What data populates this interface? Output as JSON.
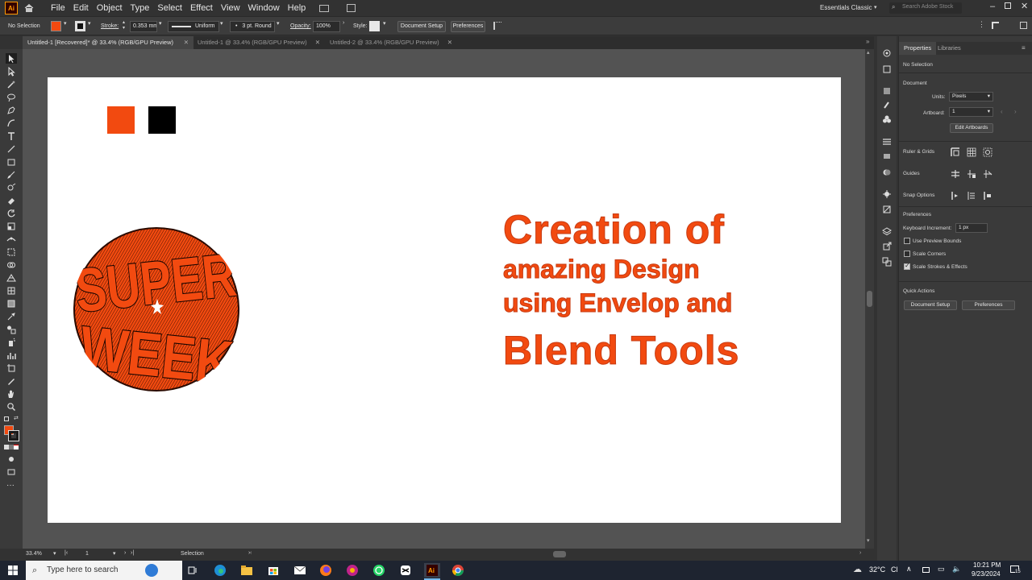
{
  "menubar": {
    "app_logo": "Ai",
    "items": [
      "File",
      "Edit",
      "Object",
      "Type",
      "Select",
      "Effect",
      "View",
      "Window",
      "Help"
    ],
    "workspace": "Essentials Classic",
    "search_placeholder": "Search Adobe Stock"
  },
  "controlbar": {
    "selection": "No Selection",
    "stroke_label": "Stroke:",
    "stroke_value": "0.353 mm",
    "profile": "Uniform",
    "brush": "3 pt. Round",
    "opacity_label": "Opacity:",
    "opacity_value": "100%",
    "style_label": "Style:",
    "doc_setup": "Document Setup",
    "preferences": "Preferences",
    "fill_color": "#f24a10"
  },
  "tabs": [
    {
      "label": "Untitled-1 [Recovered]* @ 33.4% (RGB/GPU Preview)",
      "active": true
    },
    {
      "label": "Untitled-1 @ 33.4% (RGB/GPU Preview)",
      "active": false
    },
    {
      "label": "Untitled-2 @ 33.4% (RGB/GPU Preview)",
      "active": false
    }
  ],
  "artwork": {
    "swatch_colors": [
      "#f24a10",
      "#000000"
    ],
    "logo_words": [
      "SUPER",
      "WEEK"
    ],
    "headline": [
      "Creation of",
      "amazing Design",
      "using Envelop and",
      "Blend Tools"
    ],
    "accent": "#f24a10"
  },
  "properties": {
    "tabs": [
      "Properties",
      "Libraries"
    ],
    "selection": "No Selection",
    "document_heading": "Document",
    "units_label": "Units:",
    "units_value": "Pixels",
    "artboard_label": "Artboard:",
    "artboard_value": "1",
    "edit_artboards": "Edit Artboards",
    "ruler_grids": "Ruler & Grids",
    "guides": "Guides",
    "snap_options": "Snap Options",
    "preferences_heading": "Preferences",
    "keyboard_increment_label": "Keyboard Increment:",
    "keyboard_increment_value": "1 px",
    "use_preview_bounds": "Use Preview Bounds",
    "scale_corners": "Scale Corners",
    "scale_strokes": "Scale Strokes & Effects",
    "quick_actions": "Quick Actions",
    "document_setup": "Document Setup",
    "preferences": "Preferences"
  },
  "status": {
    "zoom": "33.4%",
    "artboard": "1",
    "tool": "Selection"
  },
  "taskbar": {
    "search_placeholder": "Type here to search",
    "weather": "32°C",
    "weather_suffix": "Cl",
    "time": "10:21 PM",
    "date": "9/23/2024",
    "notifications": "15"
  }
}
